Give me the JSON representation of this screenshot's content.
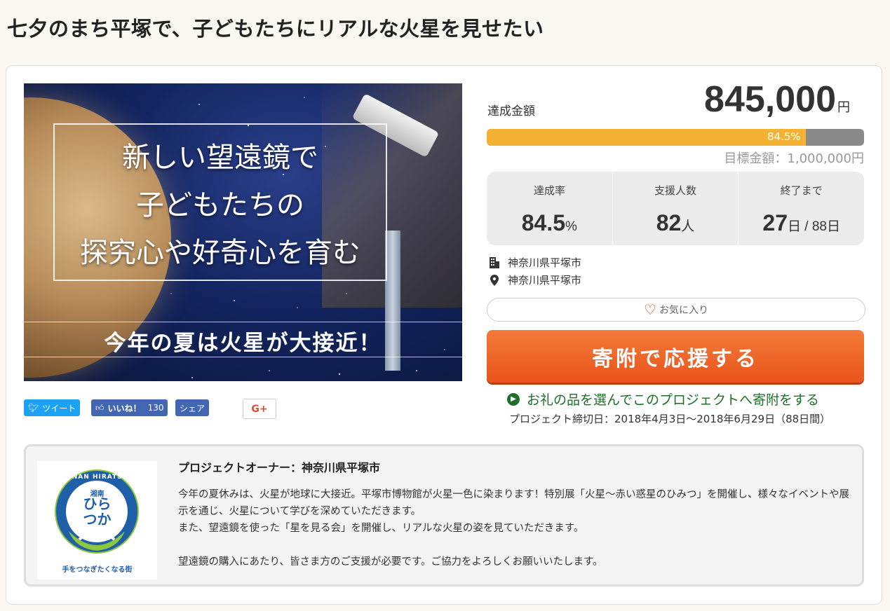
{
  "page": {
    "title": "七夕のまち平塚で、子どもたちにリアルな火星を見せたい"
  },
  "hero": {
    "copy_lines": [
      "新しい望遠鏡で",
      "子どもたちの",
      "探究心や好奇心を育む"
    ],
    "subcopy": "今年の夏は火星が大接近！"
  },
  "social": {
    "tweet": "ツイート",
    "like": "いいね！",
    "like_count": "130",
    "share": "シェア",
    "gplus": "G+"
  },
  "funding": {
    "achieved_label": "達成金額",
    "amount": "845,000",
    "amount_unit": "円",
    "progress_percent": 84.5,
    "progress_text": "84.5%",
    "goal_text": "目標金額：1,000,000円"
  },
  "stats": {
    "rate": {
      "label": "達成率",
      "value": "84.5",
      "unit": "%"
    },
    "supporters": {
      "label": "支援人数",
      "value": "82",
      "unit": "人"
    },
    "remaining": {
      "label": "終了まで",
      "value": "27",
      "unit": "日 / 88日"
    }
  },
  "location": {
    "org": "神奈川県平塚市",
    "place": "神奈川県平塚市"
  },
  "actions": {
    "favorite": "お気に入り",
    "donate": "寄附で応援する",
    "gift_link": "お礼の品を選んでこのプロジェクトへ寄附をする",
    "period": "プロジェクト締切日：2018年4月3日〜2018年6月29日（88日間）"
  },
  "owner": {
    "title": "プロジェクトオーナー：神奈川県平塚市",
    "paragraphs": [
      "今年の夏休みは、火星が地球に大接近。平塚市博物館が火星一色に染まります！特別展「火星〜赤い惑星のひみつ」を開催し、様々なイベントや展示を通じ、火星について学びを深めていただきます。",
      "また、望遠鏡を使った「星を見る会」を開催し、リアルな火星の姿を見ていただきます。",
      "",
      "望遠鏡の購入にあたり、皆さま方のご支援が必要です。ご協力をよろしくお願いいたします。"
    ],
    "logo": {
      "top_text": "SHONAN HIRATSUKA",
      "small_label": "湘南",
      "name_line1": "ひら",
      "name_line2": "つか",
      "tagline": "手をつなぎたくなる街"
    }
  },
  "colors": {
    "progress_fill": "#f3b233",
    "progress_track": "#8a8a8a",
    "donate": "#e9541b",
    "gift_link": "#1f6e2b",
    "logo_blue": "#1f5fa8",
    "logo_green": "#8dc63f"
  }
}
